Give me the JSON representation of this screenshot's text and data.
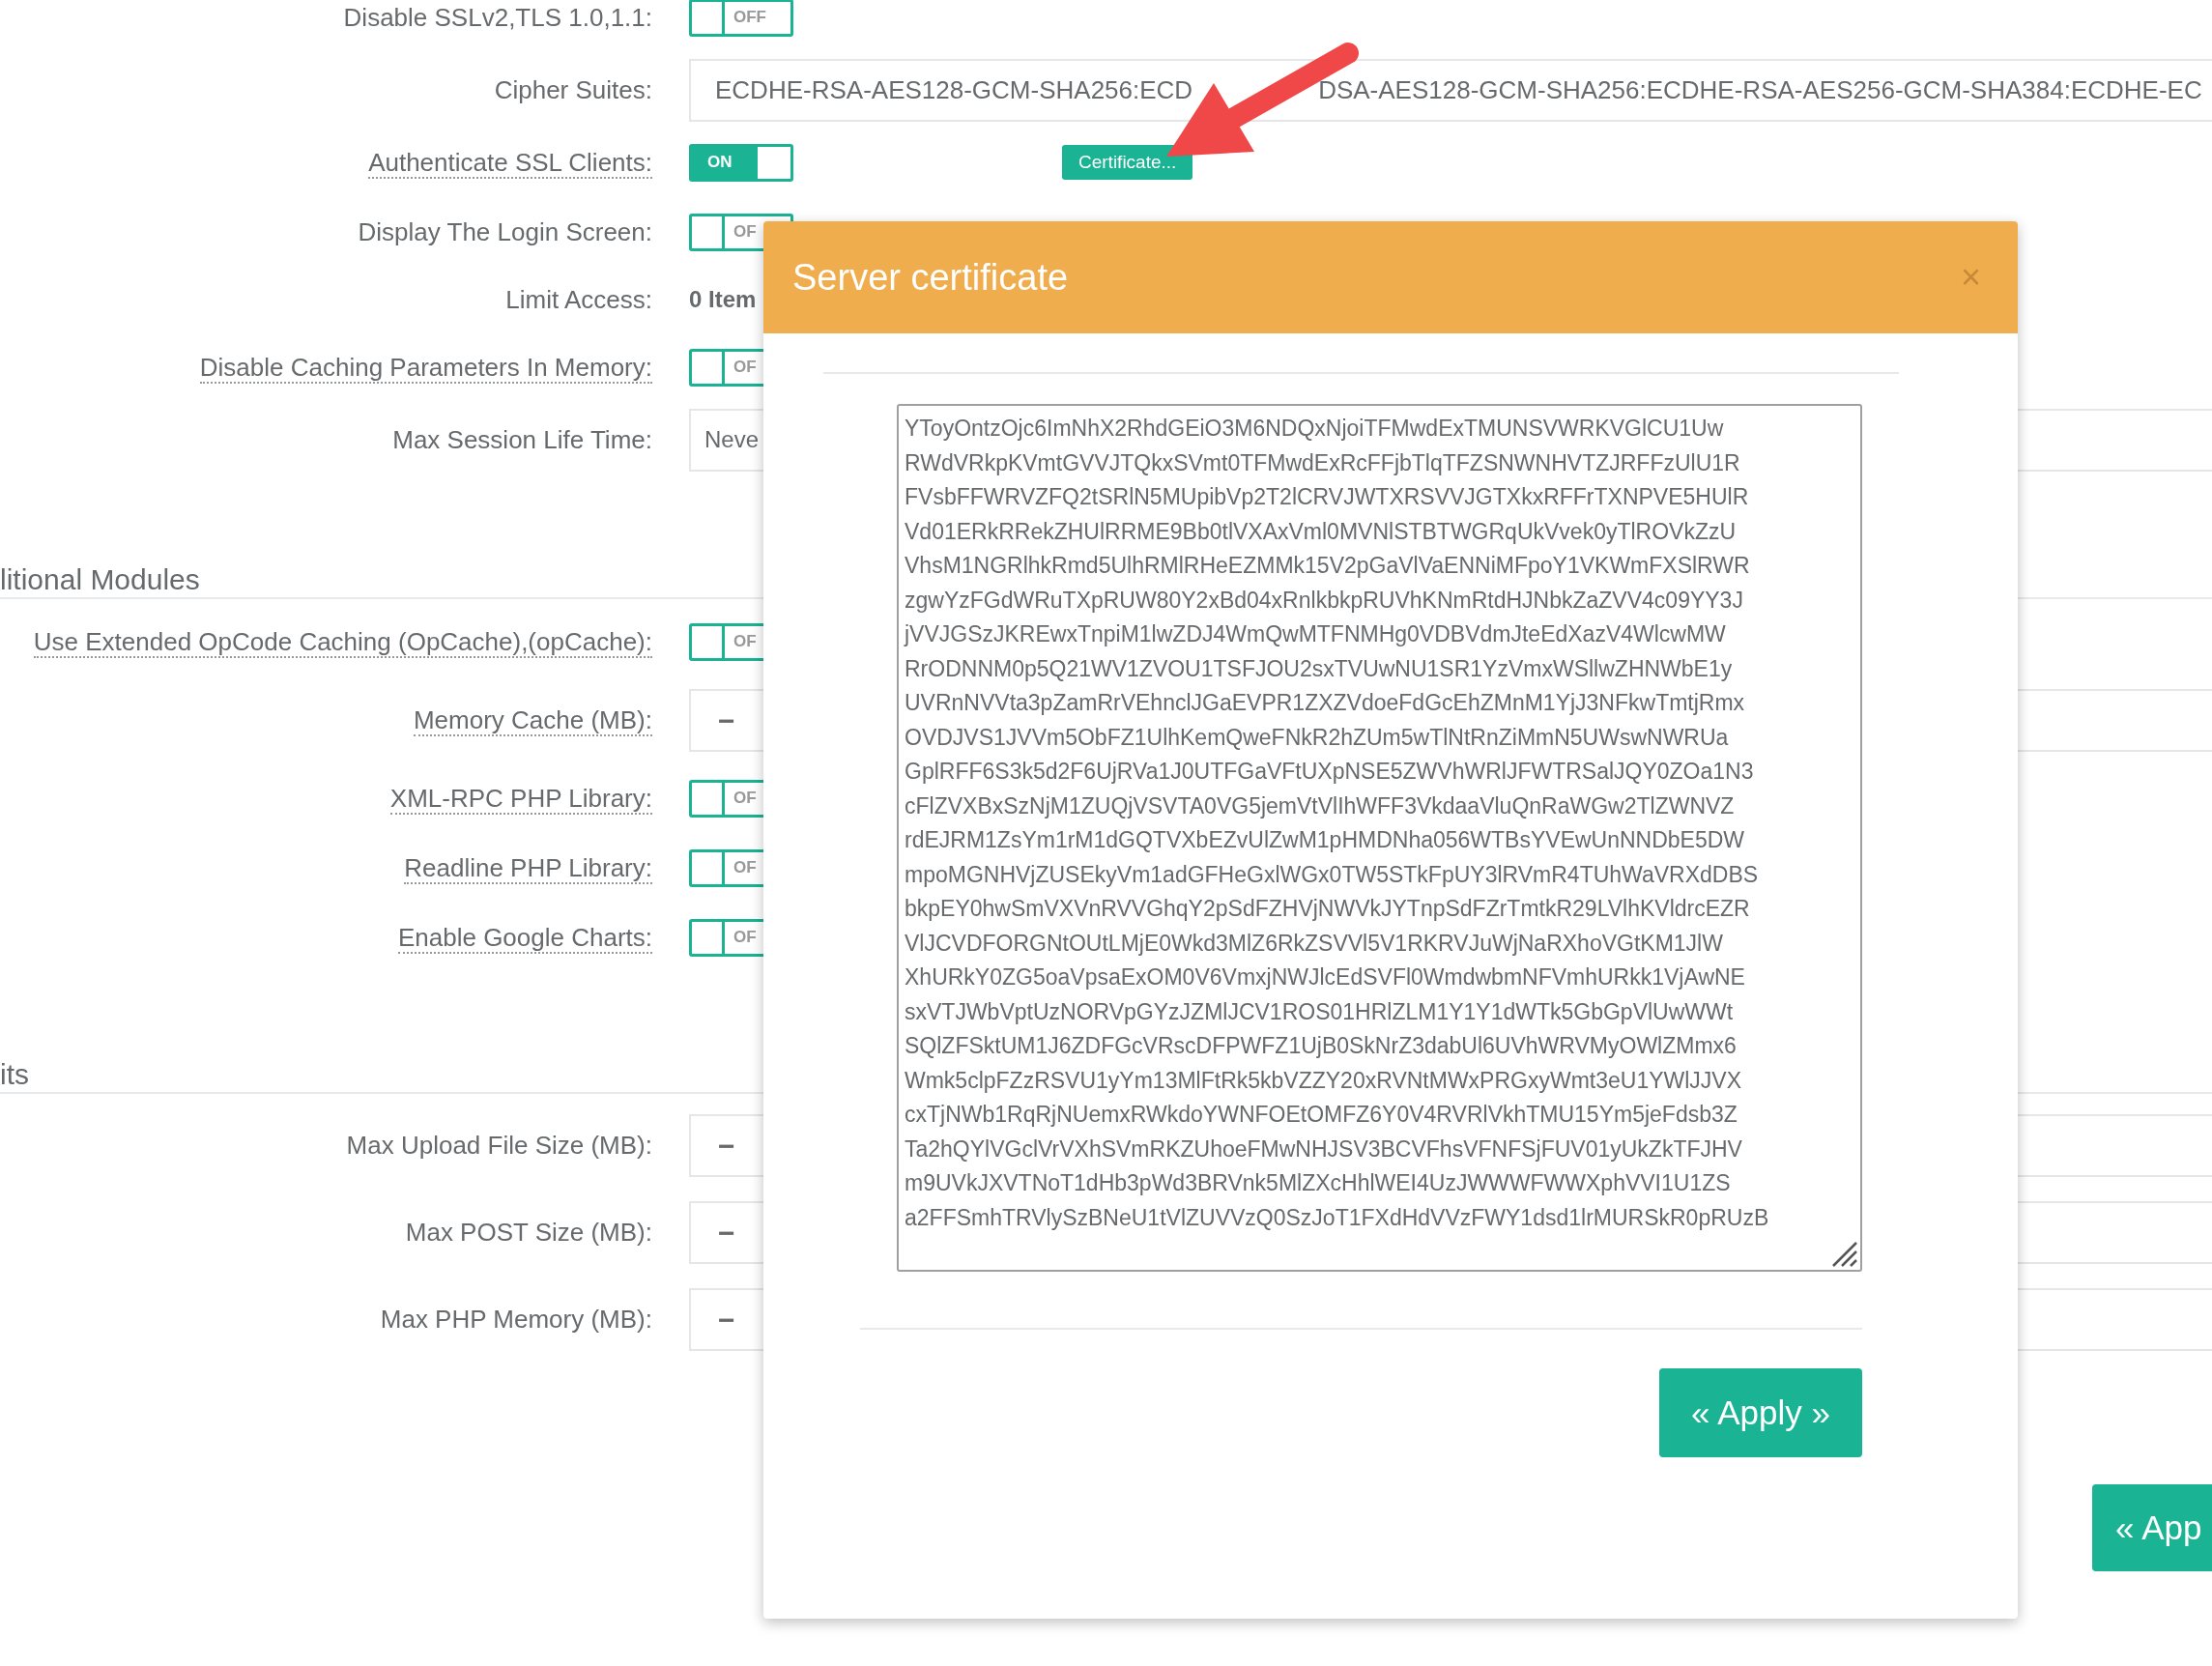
{
  "form": [
    {
      "kind": "toggle",
      "label": "Disable SSLv2,TLS 1.0,1.1:",
      "help": false,
      "on": false,
      "toggle_text": "OFF"
    },
    {
      "kind": "text",
      "label": "Cipher Suites:",
      "help": false,
      "value_parts": [
        "ECDHE-RSA-AES128-GCM-SHA256:ECD",
        "DSA-AES128-GCM-SHA256:ECDHE-RSA-AES256-GCM-SHA384:ECDHE-EC"
      ]
    },
    {
      "kind": "toggle",
      "label": "Authenticate SSL Clients:",
      "help": true,
      "on": true,
      "toggle_text": "ON",
      "button": "Certificate..."
    },
    {
      "kind": "toggle",
      "label": "Display The Login Screen:",
      "help": false,
      "on": false,
      "toggle_text": "OF"
    },
    {
      "kind": "items",
      "label": "Limit Access:",
      "help": false,
      "value": "0 Item"
    },
    {
      "kind": "toggle",
      "label": "Disable Caching Parameters In Memory:",
      "help": true,
      "on": false,
      "toggle_text": "OF"
    },
    {
      "kind": "text",
      "label": "Max Session Life Time:",
      "help": false,
      "value": "Neve"
    },
    {
      "kind": "section",
      "label": "litional Modules"
    },
    {
      "kind": "toggle",
      "label": "Use Extended OpCode Caching (OpCache),(opCache):",
      "help": true,
      "on": false,
      "toggle_text": "OF"
    },
    {
      "kind": "number",
      "label": "Memory Cache (MB):",
      "help": true,
      "value": "−"
    },
    {
      "kind": "toggle",
      "label": "XML-RPC PHP Library:",
      "help": true,
      "on": false,
      "toggle_text": "OF"
    },
    {
      "kind": "toggle",
      "label": "Readline PHP Library:",
      "help": true,
      "on": false,
      "toggle_text": "OF"
    },
    {
      "kind": "toggle",
      "label": "Enable Google Charts:",
      "help": true,
      "on": false,
      "toggle_text": "OF"
    },
    {
      "kind": "section",
      "label": "its"
    },
    {
      "kind": "number",
      "label": "Max Upload File Size (MB):",
      "help": false,
      "value": "−"
    },
    {
      "kind": "number",
      "label": "Max POST Size (MB):",
      "help": false,
      "value": "−"
    },
    {
      "kind": "number",
      "label": "Max PHP Memory (MB):",
      "help": false,
      "value": "−"
    }
  ],
  "page_button": {
    "label": "« App"
  },
  "modal": {
    "title": "Server certificate",
    "close": "×",
    "certificate_lines": [
      "YToyOntzOjc6ImNhX2RhdGEiO3M6NDQxNjoiTFMwdExTMUNSVWRKVGlCU1Uw",
      "RWdVRkpKVmtGVVJTQkxSVmt0TFMwdExRcFFjbTlqTFZSNWNHVTZJRFFzUlU1R",
      "FVsbFFWRVZFQ2tSRlN5MUpibVp2T2lCRVJWTXRSVVJGTXkxRFFrTXNPVE5HUlR",
      "Vd01ERkRRekZHUlRRME9Bb0tlVXAxVml0MVNlSTBTWGRqUkVvek0yTlROVkZzU",
      "VhsM1NGRlhkRmd5UlhRMlRHeEZMMk15V2pGaVlVaENNiMFpoY1VKWmFXSlRWR",
      "zgwYzFGdWRuTXpRUW80Y2xBd04xRnlkbkpRUVhKNmRtdHJNbkZaZVV4c09YY3J",
      "jVVJGSzJKREwxTnpiM1lwZDJ4WmQwMTFNMHg0VDBVdmJteEdXazV4WlcwMW",
      "RrODNNM0p5Q21WV1ZVOU1TSFJOU2sxTVUwNU1SR1YzVmxWSllwZHNWbE1y",
      "UVRnNVVta3pZamRrVEhnclJGaEVPR1ZXZVdoeFdGcEhZMnM1YjJ3NFkwTmtjRmx",
      "OVDJVS1JVVm5ObFZ1UlhKemQweFNkR2hZUm5wTlNtRnZiMmN5UWswNWRUa",
      "GplRFF6S3k5d2F6UjRVa1J0UTFGaVFtUXpNSE5ZWVhWRlJFWTRSalJQY0ZOa1N3",
      "cFlZVXBxSzNjM1ZUQjVSVTA0VG5jemVtVlIhWFF3VkdaaVluQnRaWGw2TlZWNVZ",
      "rdEJRM1ZsYm1rM1dGQTVXbEZvUlZwM1pHMDNha056WTBsYVEwUnNNDbE5DW",
      "mpoMGNHVjZUSEkyVm1adGFHeGxlWGx0TW5STkFpUY3lRVmR4TUhWaVRXdDBS",
      "bkpEY0hwSmVXVnRVVGhqY2pSdFZHVjNWVkJYTnpSdFZrTmtkR29LVlhKVldrcEZR",
      "VlJCVDFORGNtOUtLMjE0Wkd3MlZ6RkZSVVl5V1RKRVJuWjNaRXhoVGtKM1JlW",
      "XhURkY0ZG5oaVpsaExOM0V6VmxjNWJlcEdSVFl0WmdwbmNFVmhURkk1VjAwNE",
      "sxVTJWbVptUzNORVpGYzJZMlJCV1ROS01HRlZLM1Y1Y1dWTk5GbGpVlUwWWt",
      "SQlZFSktUM1J6ZDFGcVRscDFPWFZ1UjB0SkNrZ3dabUl6UVhWRVMyOWlZMmx6",
      "Wmk5clpFZzRSVU1yYm13MlFtRk5kbVZZY20xRVNtMWxPRGxyWmt3eU1YWlJJVX",
      "cxTjNWb1RqRjNUemxRWkdoYWNFOEtOMFZ6Y0V4RVRlVkhTMU15Ym5jeFdsb3Z",
      "Ta2hQYlVGclVrVXhSVmRKZUhoeFMwNHJSV3BCVFhsVFNFSjFUV01yUkZkTFJHV",
      "m9UVkJXVTNoT1dHb3pWd3BRVnk5MlZXcHhlWEI4UzJWWWFWWXphVVI1U1ZS",
      "a2FFSmhTRVlySzBNeU1tVlZUVVzQ0SzJoT1FXdHdVVzFWY1dsd1lrMURSkR0pRUzB"
    ],
    "apply": "« Apply »"
  }
}
